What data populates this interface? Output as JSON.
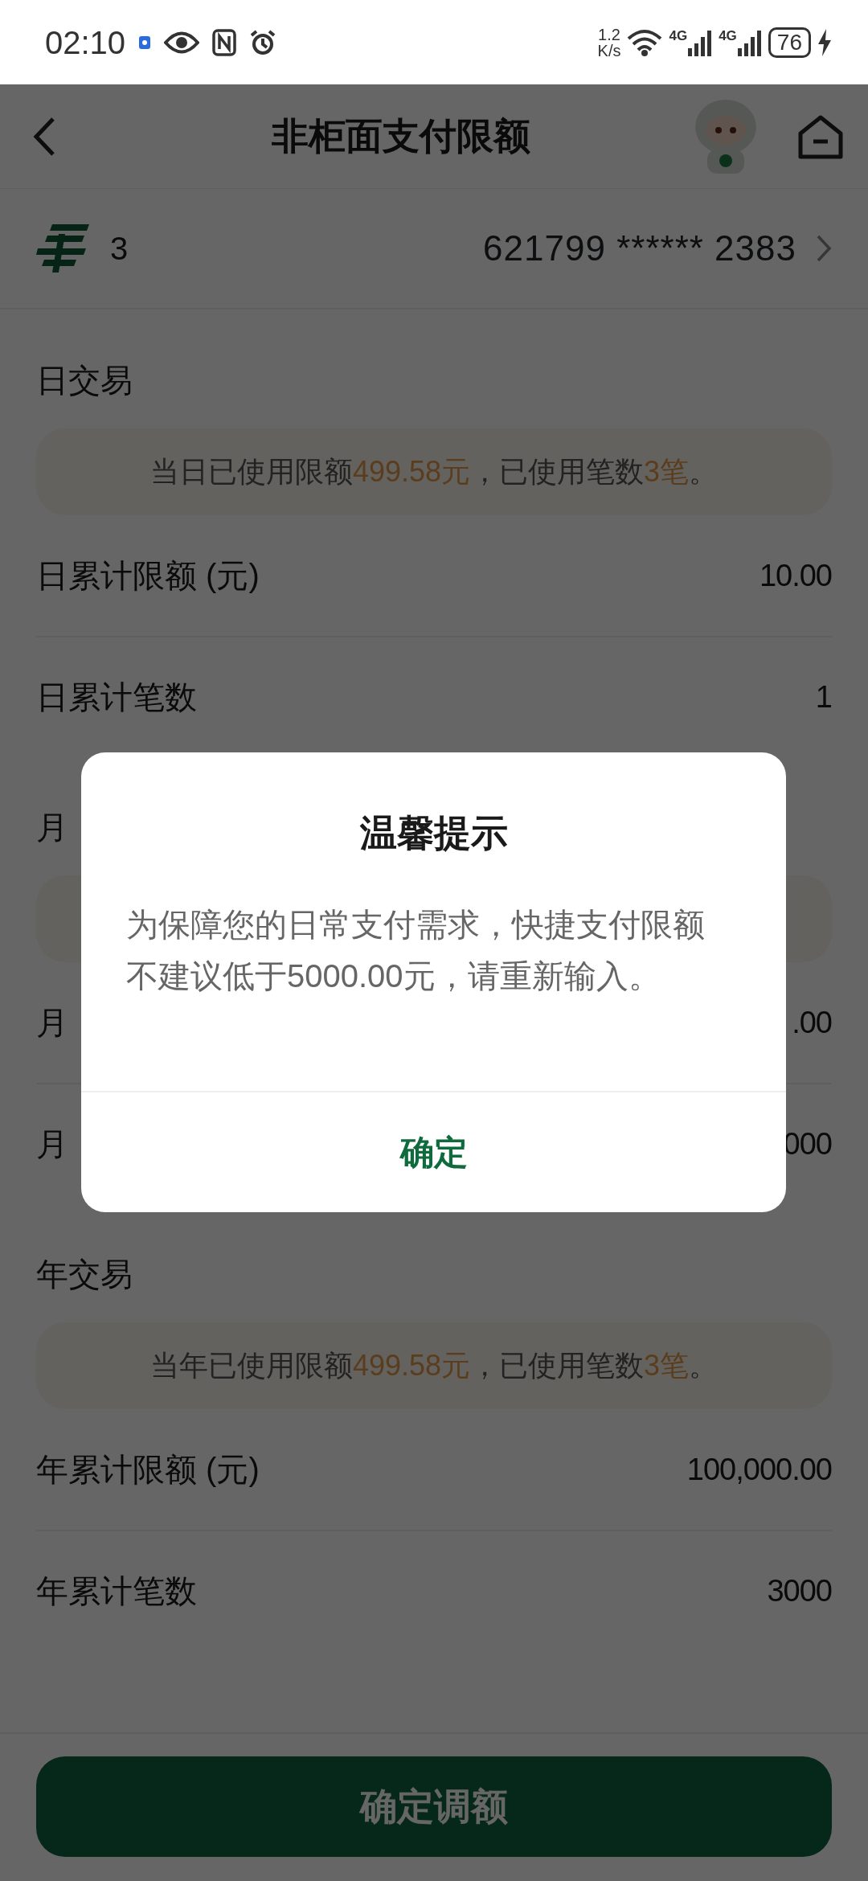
{
  "status_bar": {
    "time": "02:10",
    "net_speed_value": "1.2",
    "net_speed_unit": "K/s",
    "signal_labels": [
      "4G",
      "4G"
    ],
    "battery": "76"
  },
  "header": {
    "title": "非柜面支付限额"
  },
  "account": {
    "name": "3",
    "card_number": "621799 ****** 2383"
  },
  "sections": [
    {
      "title": "日交易",
      "info": [
        {
          "text": "当日已使用限额",
          "highlight": false
        },
        {
          "text": "499.58元",
          "highlight": true
        },
        {
          "text": "，已使用笔数",
          "highlight": false
        },
        {
          "text": "3笔",
          "highlight": true
        },
        {
          "text": "。",
          "highlight": false
        }
      ],
      "rows": [
        {
          "label": "日累计限额 (元)",
          "value": "10.00"
        },
        {
          "label": "日累计笔数",
          "value": "1"
        }
      ]
    },
    {
      "title": "月",
      "rows": [
        {
          "label": "月",
          "value": ".00"
        },
        {
          "label": "月",
          "value": "000"
        }
      ]
    },
    {
      "title": "年交易",
      "info": [
        {
          "text": "当年已使用限额",
          "highlight": false
        },
        {
          "text": "499.58元",
          "highlight": true
        },
        {
          "text": "，已使用笔数",
          "highlight": false
        },
        {
          "text": "3笔",
          "highlight": true
        },
        {
          "text": "。",
          "highlight": false
        }
      ],
      "rows": [
        {
          "label": "年累计限额 (元)",
          "value": "100,000.00"
        },
        {
          "label": "年累计笔数",
          "value": "3000"
        }
      ]
    }
  ],
  "submit_button": "确定调额",
  "dialog": {
    "title": "温馨提示",
    "message": "为保障您的日常支付需求，快捷支付限额不建议低于5000.00元，请重新输入。",
    "button": "确定"
  }
}
